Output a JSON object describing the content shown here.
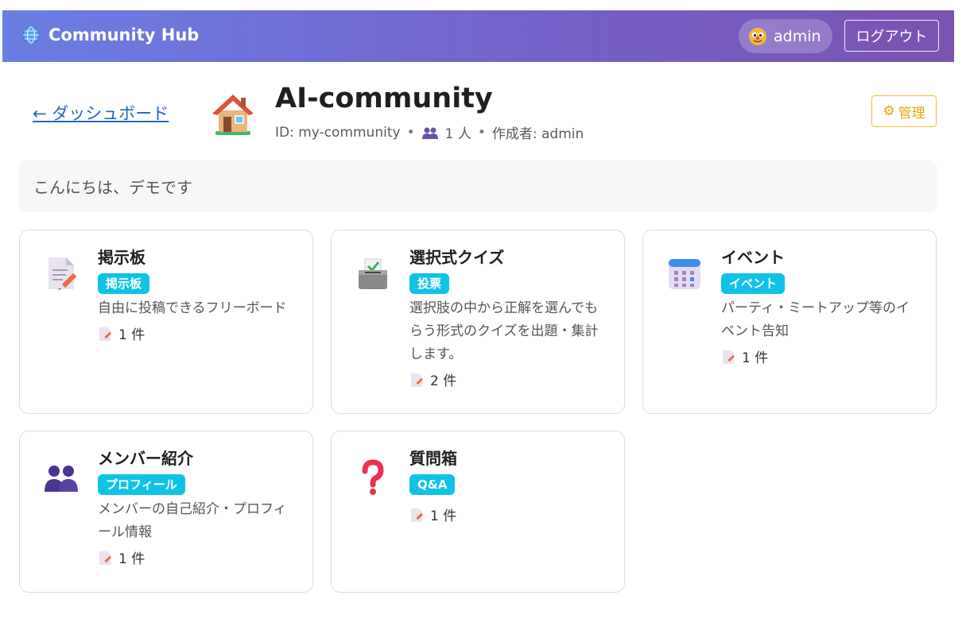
{
  "header": {
    "brand": "Community Hub",
    "user_name": "admin",
    "logout_label": "ログアウト"
  },
  "page": {
    "back_label": "← ダッシュボード",
    "title": "AI-community",
    "id_text": "ID: my-community",
    "member_count": "1 人",
    "creator": "作成者: admin",
    "manage_label": "管理",
    "greeting": "こんにちは、デモです"
  },
  "cards": [
    {
      "title": "掲示板",
      "badge": "掲示板",
      "desc": "自由に投稿できるフリーボード",
      "count": "1 件",
      "icon": "memo-icon"
    },
    {
      "title": "選択式クイズ",
      "badge": "投票",
      "desc": "選択肢の中から正解を選んでもらう形式のクイズを出題・集計します。",
      "count": "2 件",
      "icon": "ballot-box-icon"
    },
    {
      "title": "イベント",
      "badge": "イベント",
      "desc": "パーティ・ミートアップ等のイベント告知",
      "count": "1 件",
      "icon": "calendar-icon"
    },
    {
      "title": "メンバー紹介",
      "badge": "プロフィール",
      "desc": "メンバーの自己紹介・プロフィール情報",
      "count": "1 件",
      "icon": "people-icon"
    },
    {
      "title": "質問箱",
      "badge": "Q&A",
      "desc": "",
      "count": "1 件",
      "icon": "question-mark-icon"
    }
  ],
  "colors": {
    "header_gradient_start": "#6a7fe3",
    "header_gradient_end": "#7a52b0",
    "badge": "#10c3e6",
    "manage_accent": "#e5a90e",
    "link": "#2266c4"
  }
}
